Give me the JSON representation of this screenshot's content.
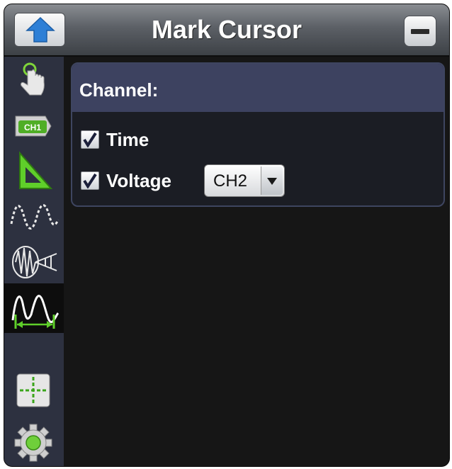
{
  "header": {
    "title": "Mark Cursor",
    "up_icon": "up-arrow-icon",
    "minimize_icon": "minimize-icon"
  },
  "sidebar": {
    "items": [
      {
        "icon": "touch-hand-icon",
        "active": false
      },
      {
        "icon": "ch1-channel-icon",
        "active": false
      },
      {
        "icon": "triangle-ruler-icon",
        "active": false
      },
      {
        "icon": "sine-wave-icon",
        "active": false
      },
      {
        "icon": "fft-waveform-icon",
        "active": false
      },
      {
        "icon": "cursor-measure-wave-icon",
        "active": true
      },
      {
        "icon": "crosshair-icon",
        "active": false
      },
      {
        "icon": "gear-icon",
        "active": false
      }
    ]
  },
  "panel": {
    "title": "Channel:",
    "time": {
      "label": "Time",
      "checked": true
    },
    "voltage": {
      "label": "Voltage",
      "checked": true,
      "selected": "CH2"
    }
  },
  "colors": {
    "accent_green": "#5fcf2a",
    "panel_header": "#3d4260",
    "sidebar": "#2d3140",
    "background": "#161616"
  }
}
